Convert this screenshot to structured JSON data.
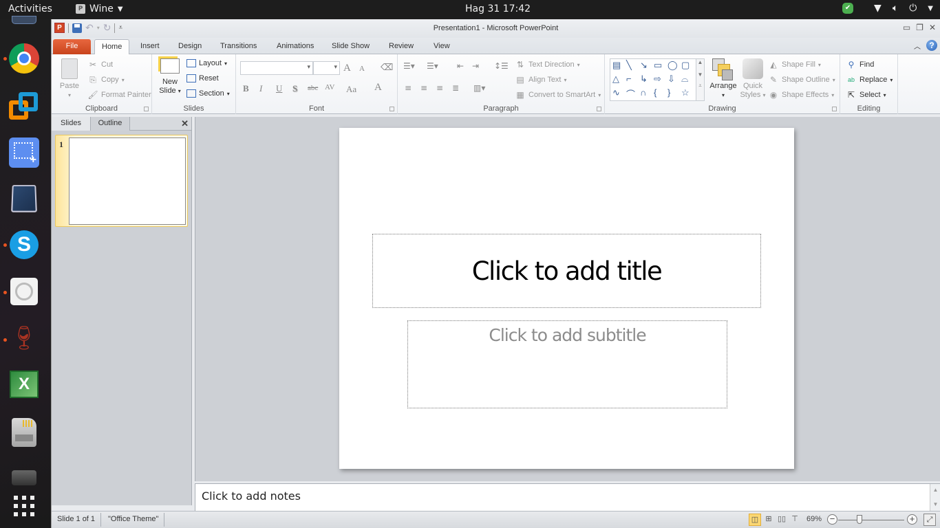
{
  "topbar": {
    "activities": "Activities",
    "app_name": "Wine",
    "clock": "Hag 31  17:42",
    "tray_icons": [
      "shield-check-icon",
      "wifi-icon",
      "volume-icon",
      "power-icon",
      "chevron-down-icon"
    ]
  },
  "dock": {
    "items": [
      {
        "name": "files",
        "running": false
      },
      {
        "name": "chrome",
        "running": true
      },
      {
        "name": "vmware",
        "running": false
      },
      {
        "name": "screenshot",
        "running": false
      },
      {
        "name": "virtualbox",
        "running": false
      },
      {
        "name": "skype",
        "running": true
      },
      {
        "name": "settings",
        "running": true
      },
      {
        "name": "wine",
        "running": true
      },
      {
        "name": "excel",
        "running": false
      },
      {
        "name": "sd-card",
        "running": false
      },
      {
        "name": "drive",
        "running": false
      },
      {
        "name": "show-apps",
        "running": false
      }
    ]
  },
  "window": {
    "title": "Presentation1  -  Microsoft PowerPoint",
    "logo": "P"
  },
  "tabs": {
    "file": "File",
    "items": [
      "Home",
      "Insert",
      "Design",
      "Transitions",
      "Animations",
      "Slide Show",
      "Review",
      "View"
    ],
    "active": "Home"
  },
  "ribbon": {
    "clipboard": {
      "label": "Clipboard",
      "paste": "Paste",
      "cut": "Cut",
      "copy": "Copy",
      "format_painter": "Format Painter"
    },
    "slides": {
      "label": "Slides",
      "new_slide_1": "New",
      "new_slide_2": "Slide",
      "layout": "Layout",
      "reset": "Reset",
      "section": "Section"
    },
    "font": {
      "label": "Font",
      "font_name": "",
      "font_size": "",
      "grow": "A",
      "shrink": "A",
      "bold": "B",
      "italic": "I",
      "underline": "U",
      "shadow": "S",
      "strike": "abc",
      "spacing": "AV",
      "case": "Aa",
      "color": "A"
    },
    "paragraph": {
      "label": "Paragraph",
      "text_direction": "Text Direction",
      "align_text": "Align Text",
      "convert_smartart": "Convert to SmartArt"
    },
    "drawing": {
      "label": "Drawing",
      "arrange": "Arrange",
      "quick_styles_1": "Quick",
      "quick_styles_2": "Styles",
      "shape_fill": "Shape Fill",
      "shape_outline": "Shape Outline",
      "shape_effects": "Shape Effects"
    },
    "editing": {
      "label": "Editing",
      "find": "Find",
      "replace": "Replace",
      "select": "Select"
    }
  },
  "slides_pane": {
    "tab_slides": "Slides",
    "tab_outline": "Outline",
    "active_tab": "Slides",
    "thumbnails": [
      {
        "number": "1"
      }
    ]
  },
  "slide": {
    "title_placeholder": "Click to add title",
    "subtitle_placeholder": "Click to add subtitle"
  },
  "notes": {
    "placeholder": "Click to add notes"
  },
  "status": {
    "slide_info": "Slide 1 of 1",
    "theme": "\"Office Theme\"",
    "zoom": "69%",
    "zoom_value_percent": 69
  }
}
